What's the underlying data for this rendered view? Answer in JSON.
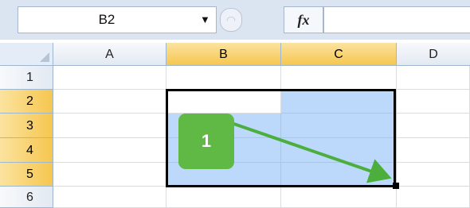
{
  "formula_bar": {
    "name_box_value": "B2",
    "fx_label": "fx",
    "formula_value": ""
  },
  "columns": [
    "A",
    "B",
    "C",
    "D"
  ],
  "rows": [
    "1",
    "2",
    "3",
    "4",
    "5",
    "6"
  ],
  "selection": {
    "range": "B2:C5",
    "active_cell": "B2"
  },
  "callout": {
    "label": "1"
  },
  "colors": {
    "selection_fill": "#bcd9fb",
    "header_selected": "#f6c64f",
    "callout": "#5fb944",
    "arrow": "#4cae3c"
  },
  "icons": [
    "dropdown-arrow-icon",
    "insert-function-icon",
    "fill-handle",
    "drag-arrow"
  ]
}
